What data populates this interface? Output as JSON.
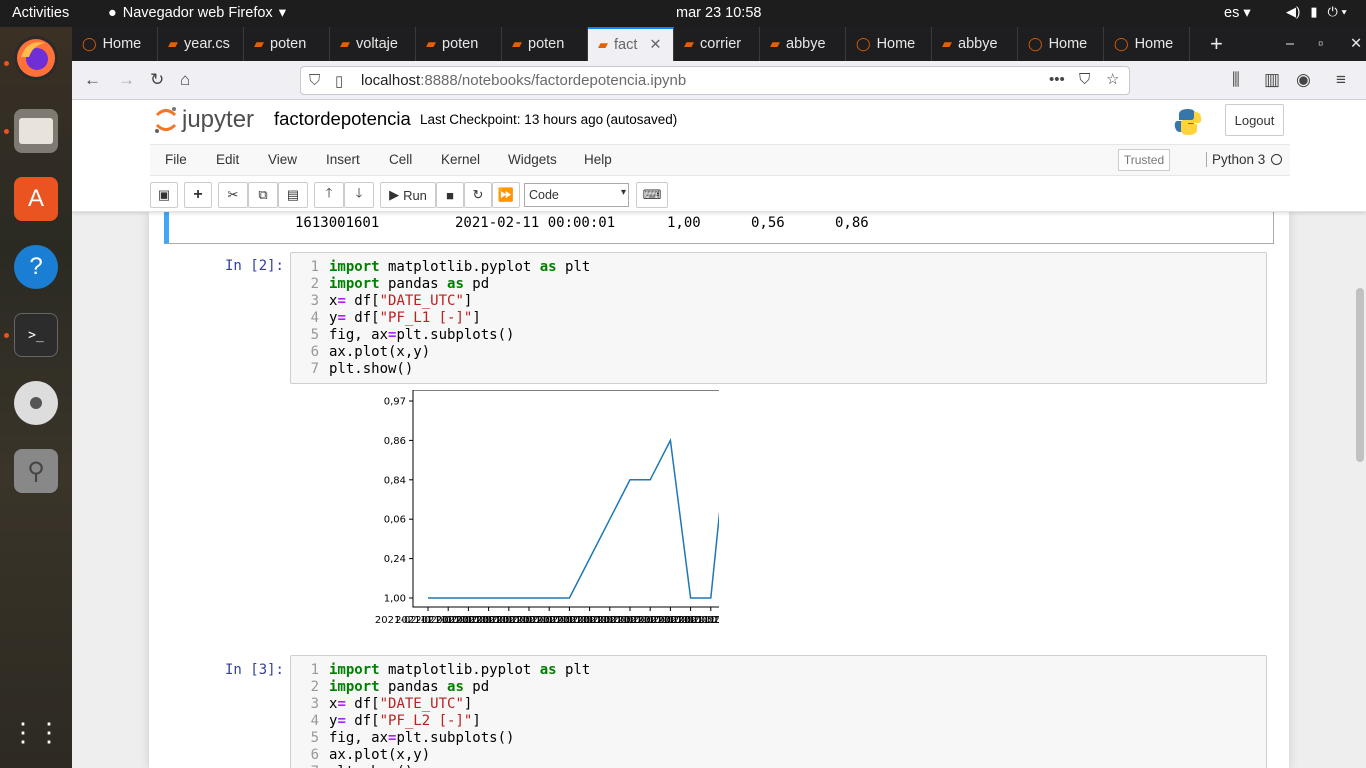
{
  "topbar": {
    "activities": "Activities",
    "app": "Navegador web Firefox",
    "clock": "mar 23  10:58",
    "lang": "es"
  },
  "tabs": [
    "Home",
    "year.cs",
    "poten",
    "voltaje",
    "poten",
    "poten",
    "fact",
    "corrier",
    "abbye",
    "Home",
    "abbye",
    "Home",
    "Home"
  ],
  "url": {
    "host": "localhost",
    "path": ":8888/notebooks/factordepotencia.ipynb"
  },
  "jupyter": {
    "logo": "jupyter",
    "title": "factordepotencia",
    "checkpoint": "Last Checkpoint: 13 hours ago",
    "autosave": "(autosaved)",
    "logout": "Logout",
    "trusted": "Trusted",
    "kernel": "Python 3"
  },
  "menu": [
    "File",
    "Edit",
    "View",
    "Insert",
    "Cell",
    "Kernel",
    "Widgets",
    "Help"
  ],
  "toolbar": {
    "run": "Run",
    "celltype": "Code"
  },
  "prev_output": [
    "1613001601",
    "2021-02-11 00:00:01",
    "1,00",
    "0,56",
    "0,86"
  ],
  "cell2": {
    "prompt": "In [2]:",
    "lines": [
      [
        [
          "k",
          "import"
        ],
        [
          "t",
          " matplotlib.pyplot "
        ],
        [
          "k",
          "as"
        ],
        [
          "t",
          " plt"
        ]
      ],
      [
        [
          "k",
          "import"
        ],
        [
          "t",
          " pandas "
        ],
        [
          "k",
          "as"
        ],
        [
          "t",
          " pd"
        ]
      ],
      [
        [
          "t",
          "x"
        ],
        [
          "o",
          "="
        ],
        [
          "t",
          " df["
        ],
        [
          "s",
          "\"DATE_UTC\""
        ],
        [
          "t",
          "]"
        ]
      ],
      [
        [
          "t",
          "y"
        ],
        [
          "o",
          "="
        ],
        [
          "t",
          " df["
        ],
        [
          "s",
          "\"PF_L1 [-]\""
        ],
        [
          "t",
          "]"
        ]
      ],
      [
        [
          "t",
          "fig, ax"
        ],
        [
          "o",
          "="
        ],
        [
          "t",
          "plt.subplots()"
        ]
      ],
      [
        [
          "t",
          "ax.plot(x,y)"
        ]
      ],
      [
        [
          "t",
          "plt.show()"
        ]
      ]
    ]
  },
  "cell3": {
    "prompt": "In [3]:",
    "lines": [
      [
        [
          "k",
          "import"
        ],
        [
          "t",
          " matplotlib.pyplot "
        ],
        [
          "k",
          "as"
        ],
        [
          "t",
          " plt"
        ]
      ],
      [
        [
          "k",
          "import"
        ],
        [
          "t",
          " pandas "
        ],
        [
          "k",
          "as"
        ],
        [
          "t",
          " pd"
        ]
      ],
      [
        [
          "t",
          "x"
        ],
        [
          "o",
          "="
        ],
        [
          "t",
          " df["
        ],
        [
          "s",
          "\"DATE_UTC\""
        ],
        [
          "t",
          "]"
        ]
      ],
      [
        [
          "t",
          "y"
        ],
        [
          "o",
          "="
        ],
        [
          "t",
          " df["
        ],
        [
          "s",
          "\"PF_L2 [-]\""
        ],
        [
          "t",
          "]"
        ]
      ],
      [
        [
          "t",
          "fig, ax"
        ],
        [
          "o",
          "="
        ],
        [
          "t",
          "plt.subplots()"
        ]
      ],
      [
        [
          "t",
          "ax.plot(x,y)"
        ]
      ],
      [
        [
          "t",
          "plt.show()"
        ]
      ]
    ]
  },
  "chart_data": {
    "type": "line",
    "yticks": [
      "1,00",
      "0,24",
      "0,06",
      "0,84",
      "0,86",
      "0,97"
    ],
    "values": [
      1,
      1,
      1,
      1,
      1,
      1,
      1,
      1,
      2,
      3,
      4,
      4,
      5,
      1,
      1,
      6
    ],
    "xlabel_overlap": "2021-02-11 00:00:01",
    "line_color": "#1f77b4"
  }
}
